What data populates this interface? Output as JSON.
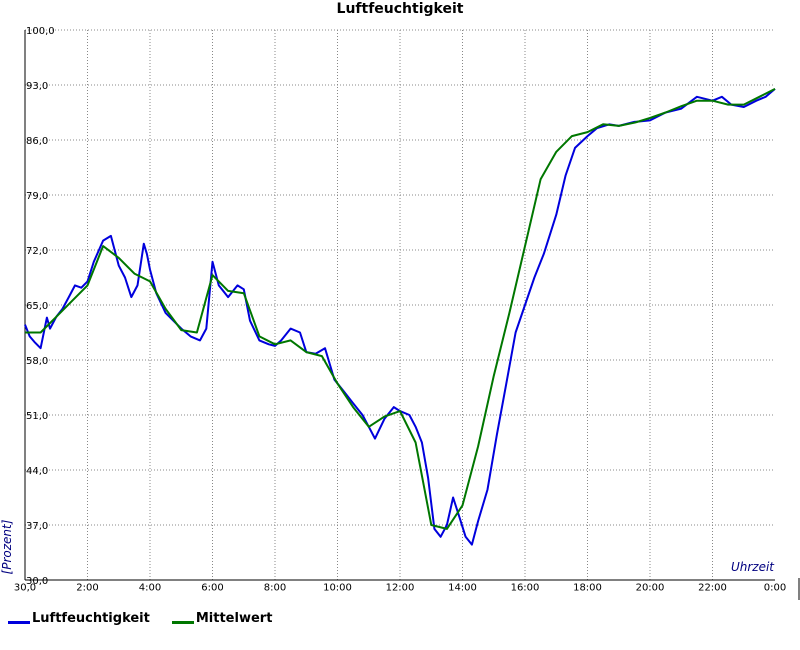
{
  "colors": {
    "series1": "#0000dd",
    "series2": "#007700",
    "grid": "#888888",
    "axis_text": "#000000",
    "axis_label": "#000080"
  },
  "legend": [
    {
      "label": "Luftfeuchtigkeit",
      "color": "#0000dd"
    },
    {
      "label": "Mittelwert",
      "color": "#007700"
    }
  ],
  "chart_data": {
    "type": "line",
    "title": "Luftfeuchtigkeit",
    "xlabel": "Uhrzeit",
    "ylabel": "[Prozent]",
    "xlim": [
      0,
      24
    ],
    "ylim": [
      30,
      100
    ],
    "grid": true,
    "legend_position": "bottom-left",
    "x_ticks": [
      {
        "x": 2,
        "label": "2:00"
      },
      {
        "x": 4,
        "label": "4:00"
      },
      {
        "x": 6,
        "label": "6:00"
      },
      {
        "x": 8,
        "label": "8:00"
      },
      {
        "x": 10,
        "label": "10:00"
      },
      {
        "x": 12,
        "label": "12:00"
      },
      {
        "x": 14,
        "label": "14:00"
      },
      {
        "x": 16,
        "label": "16:00"
      },
      {
        "x": 18,
        "label": "18:00"
      },
      {
        "x": 20,
        "label": "20:00"
      },
      {
        "x": 22,
        "label": "22:00"
      },
      {
        "x": 24,
        "label": "0:00"
      }
    ],
    "y_ticks": [
      {
        "y": 30,
        "label": "30,0"
      },
      {
        "y": 37,
        "label": "37,0"
      },
      {
        "y": 44,
        "label": "44,0"
      },
      {
        "y": 51,
        "label": "51,0"
      },
      {
        "y": 58,
        "label": "58,0"
      },
      {
        "y": 65,
        "label": "65,0"
      },
      {
        "y": 72,
        "label": "72,0"
      },
      {
        "y": 79,
        "label": "79,0"
      },
      {
        "y": 86,
        "label": "86,0"
      },
      {
        "y": 93,
        "label": "93,0"
      },
      {
        "y": 100,
        "label": "100,0"
      }
    ],
    "series": [
      {
        "name": "Luftfeuchtigkeit",
        "color": "#0000dd",
        "x": [
          0,
          0.15,
          0.3,
          0.5,
          0.7,
          0.8,
          1.0,
          1.2,
          1.4,
          1.6,
          1.8,
          2.0,
          2.2,
          2.5,
          2.75,
          3.0,
          3.2,
          3.4,
          3.6,
          3.8,
          3.9,
          4.0,
          4.2,
          4.5,
          4.8,
          5.0,
          5.3,
          5.6,
          5.8,
          6.0,
          6.2,
          6.5,
          6.8,
          7.0,
          7.2,
          7.5,
          7.8,
          8.0,
          8.2,
          8.5,
          8.8,
          9.0,
          9.3,
          9.6,
          9.9,
          10.2,
          10.5,
          10.8,
          11.0,
          11.2,
          11.5,
          11.8,
          12.0,
          12.3,
          12.5,
          12.7,
          12.9,
          13.1,
          13.3,
          13.5,
          13.7,
          13.9,
          14.1,
          14.3,
          14.5,
          14.8,
          15.1,
          15.4,
          15.7,
          16.0,
          16.3,
          16.6,
          17.0,
          17.3,
          17.6,
          18.0,
          18.3,
          18.7,
          19.0,
          19.5,
          20.0,
          20.5,
          21.0,
          21.5,
          22.0,
          22.3,
          22.6,
          23.0,
          23.4,
          23.7,
          24.0
        ],
        "y": [
          62.5,
          61.0,
          60.3,
          59.5,
          63.4,
          62.0,
          63.5,
          64.5,
          66.0,
          67.5,
          67.2,
          68.0,
          70.5,
          73.2,
          73.8,
          70.0,
          68.5,
          66.0,
          67.5,
          72.8,
          71.5,
          69.5,
          66.5,
          64.0,
          62.8,
          62.0,
          61.0,
          60.5,
          62.0,
          70.5,
          67.5,
          66.0,
          67.5,
          67.0,
          63.0,
          60.5,
          60.0,
          59.8,
          60.5,
          62.0,
          61.5,
          59.0,
          58.8,
          59.5,
          55.5,
          54.0,
          52.5,
          51.0,
          49.5,
          48.0,
          50.5,
          52.0,
          51.5,
          51.0,
          49.5,
          47.5,
          43.0,
          36.5,
          35.5,
          37.0,
          40.5,
          38.0,
          35.5,
          34.5,
          37.5,
          41.5,
          48.5,
          55.0,
          61.5,
          65.0,
          68.5,
          71.5,
          76.5,
          81.5,
          85.0,
          86.5,
          87.5,
          88.0,
          87.8,
          88.3,
          88.5,
          89.5,
          90.0,
          91.5,
          91.0,
          91.5,
          90.5,
          90.2,
          91.0,
          91.5,
          92.5
        ]
      },
      {
        "name": "Mittelwert",
        "color": "#007700",
        "x": [
          0,
          0.5,
          1.0,
          1.5,
          2.0,
          2.5,
          3.0,
          3.5,
          4.0,
          4.5,
          5.0,
          5.5,
          6.0,
          6.5,
          7.0,
          7.5,
          8.0,
          8.5,
          9.0,
          9.5,
          10.0,
          10.5,
          11.0,
          11.5,
          12.0,
          12.5,
          13.0,
          13.5,
          14.0,
          14.5,
          15.0,
          15.5,
          16.0,
          16.5,
          17.0,
          17.5,
          18.0,
          18.5,
          19.0,
          19.5,
          20.0,
          20.5,
          21.0,
          21.5,
          22.0,
          22.5,
          23.0,
          23.5,
          24.0
        ],
        "y": [
          61.5,
          61.5,
          63.5,
          65.5,
          67.5,
          72.5,
          71.0,
          69.0,
          68.0,
          64.5,
          61.8,
          61.5,
          68.8,
          66.8,
          66.5,
          61.0,
          60.0,
          60.5,
          59.0,
          58.5,
          55.0,
          52.0,
          49.5,
          50.8,
          51.5,
          47.5,
          37.0,
          36.5,
          39.5,
          47.0,
          56.0,
          64.0,
          72.5,
          81.0,
          84.5,
          86.5,
          87.0,
          88.0,
          87.8,
          88.2,
          88.8,
          89.5,
          90.3,
          91.0,
          91.0,
          90.5,
          90.5,
          91.5,
          92.5
        ]
      }
    ]
  }
}
